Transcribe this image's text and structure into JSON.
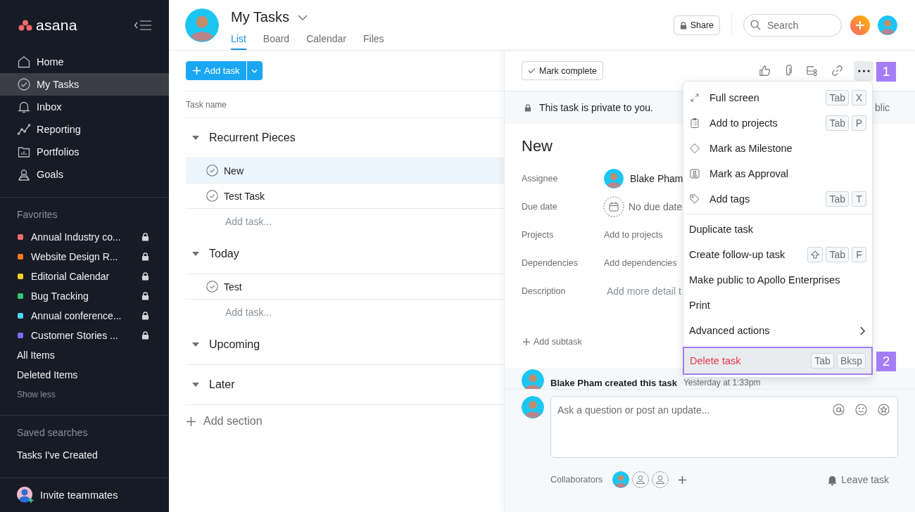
{
  "sidebar": {
    "logo": "asana",
    "nav": [
      {
        "label": "Home",
        "selected": false
      },
      {
        "label": "My Tasks",
        "selected": true
      },
      {
        "label": "Inbox",
        "selected": false
      },
      {
        "label": "Reporting",
        "selected": false
      },
      {
        "label": "Portfolios",
        "selected": false
      },
      {
        "label": "Goals",
        "selected": false
      }
    ],
    "favorites": {
      "title": "Favorites",
      "items": [
        {
          "label": "Annual Industry co...",
          "color": "#f06a6a",
          "locked": true
        },
        {
          "label": "Website Design R...",
          "color": "#fd7a1e",
          "locked": true
        },
        {
          "label": "Editorial Calendar",
          "color": "#f8d01e",
          "locked": true
        },
        {
          "label": "Bug Tracking",
          "color": "#2ecc71",
          "locked": true
        },
        {
          "label": "Annual conference...",
          "color": "#4ad9f5",
          "locked": true
        },
        {
          "label": "Customer Stories ...",
          "color": "#7a6ff0",
          "locked": true
        }
      ],
      "links": [
        "All Items",
        "Deleted Items"
      ],
      "toggle": "Show less"
    },
    "saved_searches": {
      "title": "Saved searches",
      "items": [
        "Tasks I've Created"
      ]
    },
    "invite": "Invite teammates"
  },
  "header": {
    "title": "My Tasks",
    "tabs": [
      {
        "label": "List",
        "selected": true
      },
      {
        "label": "Board",
        "selected": false
      },
      {
        "label": "Calendar",
        "selected": false
      },
      {
        "label": "Files",
        "selected": false
      }
    ],
    "share": "Share",
    "search": {
      "placeholder": "Search"
    }
  },
  "list": {
    "add_task": "Add task",
    "column": "Task name",
    "sections": [
      {
        "title": "Recurrent Pieces",
        "expanded": true,
        "tasks": [
          {
            "name": "New",
            "selected": true
          },
          {
            "name": "Test Task",
            "selected": false
          }
        ],
        "add_task": "Add task..."
      },
      {
        "title": "Today",
        "expanded": true,
        "tasks": [
          {
            "name": "Test",
            "selected": false
          }
        ],
        "add_task": "Add task..."
      },
      {
        "title": "Upcoming",
        "expanded": true
      },
      {
        "title": "Later",
        "expanded": true
      }
    ],
    "add_section": "Add section"
  },
  "detail": {
    "mark_complete": "Mark complete",
    "more_callout": "1",
    "privacy": "This task is private to you.",
    "privacy_action": "blic",
    "title": "New",
    "fields": [
      {
        "label": "Assignee",
        "kind": "person",
        "value": "Blake Pham"
      },
      {
        "label": "Due date",
        "kind": "date",
        "value": "No due date"
      },
      {
        "label": "Projects",
        "kind": "link",
        "value": "Add to projects"
      },
      {
        "label": "Dependencies",
        "kind": "link",
        "value": "Add dependencies"
      },
      {
        "label": "Description",
        "kind": "text",
        "placeholder": "Add more detail t"
      }
    ],
    "add_subtask": "Add subtask",
    "activity": {
      "text": "Blake Pham created this task",
      "time": "Yesterday at 1:33pm"
    },
    "composer": {
      "placeholder": "Ask a question or post an update..."
    },
    "collaborators": "Collaborators",
    "leave": "Leave task"
  },
  "menu": {
    "groups": [
      [
        {
          "label": "Full screen",
          "keys": [
            "Tab",
            "X"
          ],
          "shift": false,
          "submenu": false,
          "danger": false,
          "highlighted": false
        },
        {
          "label": "Add to projects",
          "keys": [
            "Tab",
            "P"
          ],
          "shift": false,
          "submenu": false,
          "danger": false,
          "highlighted": false
        },
        {
          "label": "Mark as Milestone",
          "shift": false,
          "submenu": false,
          "danger": false,
          "highlighted": false
        },
        {
          "label": "Mark as Approval",
          "shift": false,
          "submenu": false,
          "danger": false,
          "highlighted": false
        },
        {
          "label": "Add tags",
          "keys": [
            "Tab",
            "T"
          ],
          "shift": false,
          "submenu": false,
          "danger": false,
          "highlighted": false
        }
      ],
      [
        {
          "label": "Duplicate task",
          "shift": false,
          "submenu": false,
          "danger": false,
          "highlighted": false
        },
        {
          "label": "Create follow-up task",
          "keys": [
            "Tab",
            "F"
          ],
          "shift": true,
          "submenu": false,
          "danger": false,
          "highlighted": false
        },
        {
          "label": "Make public to Apollo Enterprises",
          "shift": false,
          "submenu": false,
          "danger": false,
          "highlighted": false
        },
        {
          "label": "Print",
          "shift": false,
          "submenu": false,
          "danger": false,
          "highlighted": false
        },
        {
          "label": "Advanced actions",
          "shift": false,
          "submenu": true,
          "danger": false,
          "highlighted": false
        }
      ],
      [
        {
          "label": "Delete task",
          "keys": [
            "Tab",
            "Bksp"
          ],
          "shift": false,
          "submenu": false,
          "danger": true,
          "highlighted": true,
          "callout": "2"
        }
      ]
    ]
  }
}
